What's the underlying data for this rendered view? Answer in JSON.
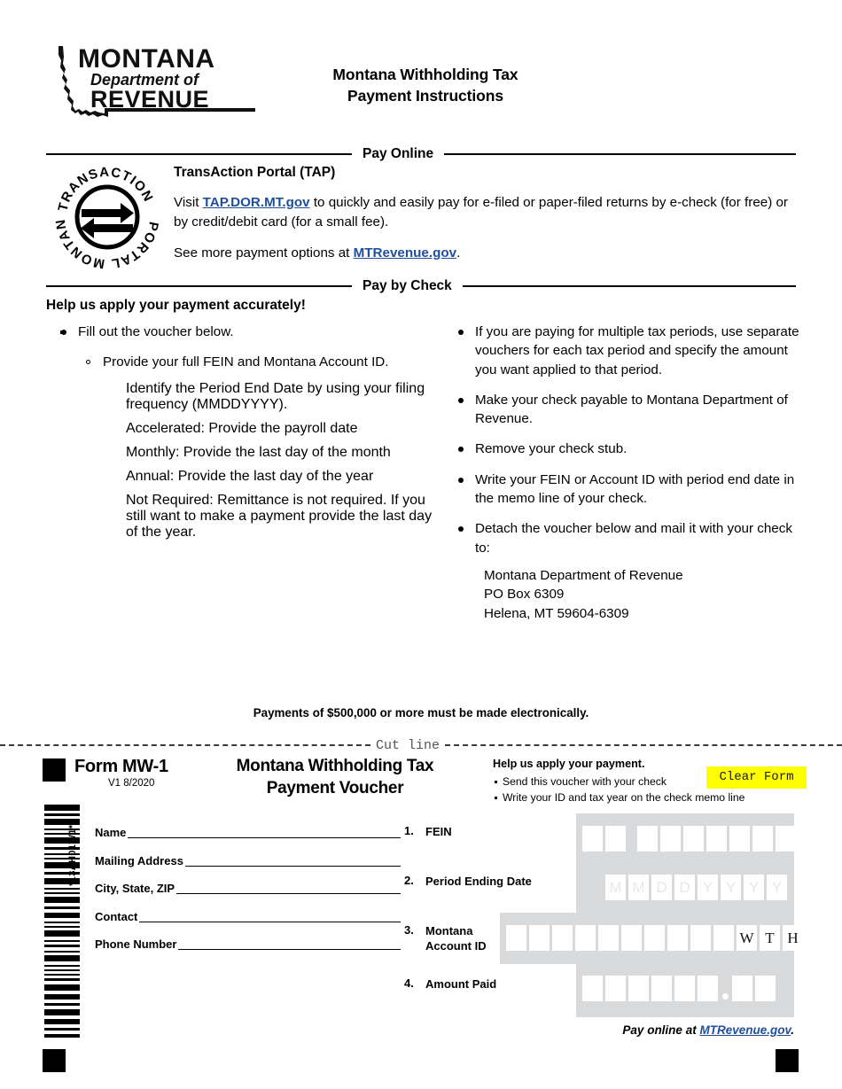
{
  "header": {
    "logo": {
      "line1": "MONTANA",
      "line2": "Department of",
      "line3": "REVENUE"
    },
    "title_line1": "Montana Withholding Tax",
    "title_line2": "Payment Instructions"
  },
  "pay_online": {
    "divider_label": "Pay Online",
    "seal_text": "MONTANA TRANSACTION PORTAL",
    "heading": "TransAction Portal (TAP)",
    "para1_pre": "Visit ",
    "para1_link": "TAP.DOR.MT.gov",
    "para1_post": " to quickly and easily pay for e-filed or paper-filed returns by e-check (for free) or by credit/debit card (for a small fee).",
    "para2_pre": "See more payment options at ",
    "para2_link": "MTRevenue.gov",
    "para2_post": "."
  },
  "pay_by_check": {
    "divider_label": "Pay by Check",
    "heading": "Help us apply your payment accurately!",
    "left_items": {
      "b1": "Fill out the voucher below.",
      "b2": "Provide your full FEIN and Montana Account ID.",
      "s1": "Identify the Period End Date by using your filing frequency (MMDDYYYY).",
      "s2": "Accelerated: Provide the payroll date",
      "s3": "Monthly: Provide the last day of the month",
      "s4": "Annual: Provide the last day of the year",
      "s5": "Not Required: Remittance is not required. If you still want to make a payment provide the last day of the year."
    },
    "right_items": {
      "r1": "If you are paying for multiple tax periods, use separate vouchers for each tax period and specify the amount you want applied to that period.",
      "r2": "Make your check payable to Montana Department of Revenue.",
      "r3": "Remove your check stub.",
      "r4": "Write your FEIN or Account ID with period end date in the memo line of your check.",
      "r5": "Detach the voucher below and mail it with your check to:"
    },
    "mail_address": {
      "line1": "Montana Department of Revenue",
      "line2": "PO Box 6309",
      "line3": "Helena, MT 59604-6309"
    }
  },
  "electronic_notice": "Payments of $500,000 or more must be made electronically.",
  "cut_line_label": "Cut line",
  "voucher": {
    "form_id": "Form MW-1",
    "form_version": "V1 8/2020",
    "title_line1": "Montana Withholding Tax",
    "title_line2": "Payment Voucher",
    "help": {
      "title": "Help us apply your payment.",
      "line1": "Send this voucher with your check",
      "line2": "Write your ID and tax year on the check memo line"
    },
    "clear_form_label": "Clear Form",
    "barcode_label": "*13AH01W1*",
    "contact_fields": [
      {
        "label": "Name",
        "value": ""
      },
      {
        "label": "Mailing Address",
        "value": ""
      },
      {
        "label": "City, State, ZIP",
        "value": ""
      },
      {
        "label": "Contact",
        "value": ""
      },
      {
        "label": "Phone Number",
        "value": ""
      }
    ],
    "numbered_fields": [
      {
        "num": "1.",
        "label": "FEIN"
      },
      {
        "num": "2.",
        "label": "Period Ending Date"
      },
      {
        "num": "3.",
        "label": "Montana Account ID"
      },
      {
        "num": "4.",
        "label": "Amount Paid"
      }
    ],
    "fein_boxes": 9,
    "period_placeholders": [
      "M",
      "M",
      "D",
      "D",
      "Y",
      "Y",
      "Y",
      "Y"
    ],
    "account_id_empty_boxes": 10,
    "account_id_suffix": [
      "W",
      "T",
      "H"
    ],
    "amount_boxes_before_decimal": 6,
    "amount_boxes_after_decimal": 2,
    "footer_pre": "Pay online at ",
    "footer_link": "MTRevenue.gov",
    "footer_post": "."
  },
  "colors": {
    "link": "#1f4e9c",
    "field_background": "#d9dadc",
    "clear_form_background": "#ffff00",
    "placeholder": "#e6e7e9"
  }
}
